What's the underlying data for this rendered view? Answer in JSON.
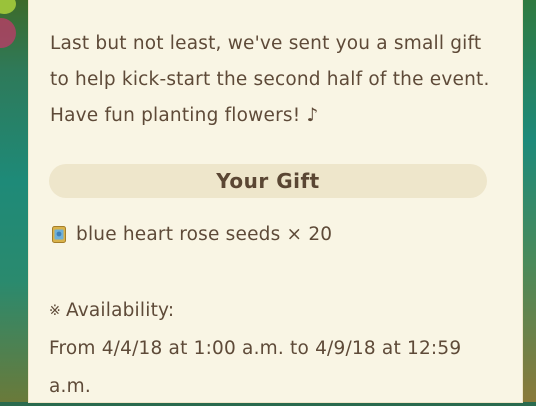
{
  "message": {
    "text": "Last but not least, we've sent you a small gift to help kick-start the second half of the event. Have fun planting flowers! ♪"
  },
  "gift": {
    "header": "Your Gift",
    "item": {
      "icon": "seed-packet-icon",
      "label": "blue heart rose seeds × 20"
    }
  },
  "availability": {
    "mark": "※",
    "heading": "Availability:",
    "text": "From 4/4/18 at 1:00 a.m. to 4/9/18 at 12:59 a.m."
  },
  "colors": {
    "panel_background": "#f9f5e4",
    "header_pill": "#eee6cb",
    "text": "#5e4a38"
  }
}
